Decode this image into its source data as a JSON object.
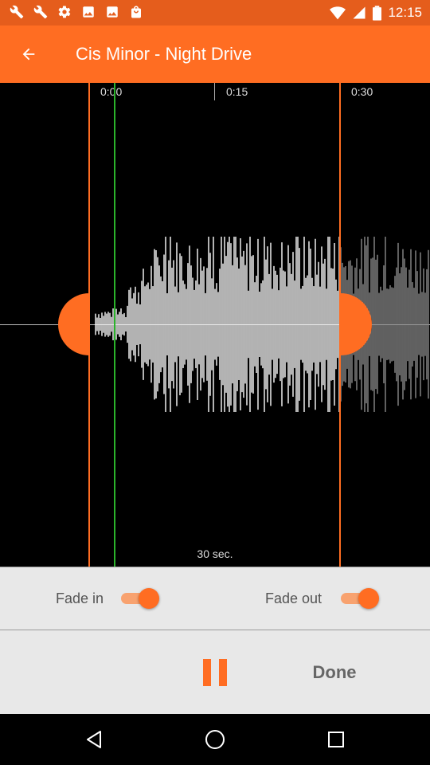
{
  "status_bar": {
    "time": "12:15",
    "icons": [
      "wrench-icon",
      "wrench-icon",
      "gear-icon",
      "image-icon",
      "image-icon",
      "shopping-bag-icon"
    ],
    "wifi_icon": "wifi-icon",
    "signal_icon": "signal-icon",
    "battery_icon": "battery-icon"
  },
  "app_bar": {
    "back_icon": "arrow-left-icon",
    "title": "Cis Minor - Night Drive"
  },
  "timeline": {
    "tick_labels": [
      "0:00",
      "0:15",
      "0:30"
    ],
    "selection_duration": "30 sec."
  },
  "fade": {
    "fade_in_label": "Fade in",
    "fade_in_on": true,
    "fade_out_label": "Fade out",
    "fade_out_on": true
  },
  "actions": {
    "pause_icon": "pause-icon",
    "done_label": "Done"
  },
  "nav_bar": {
    "back": "triangle-back-icon",
    "home": "circle-home-icon",
    "recents": "square-recents-icon"
  },
  "colors": {
    "accent": "#ff6d22",
    "status_bar": "#e55d1c",
    "playhead": "#2bb32b",
    "panel": "#e8e8e8"
  }
}
